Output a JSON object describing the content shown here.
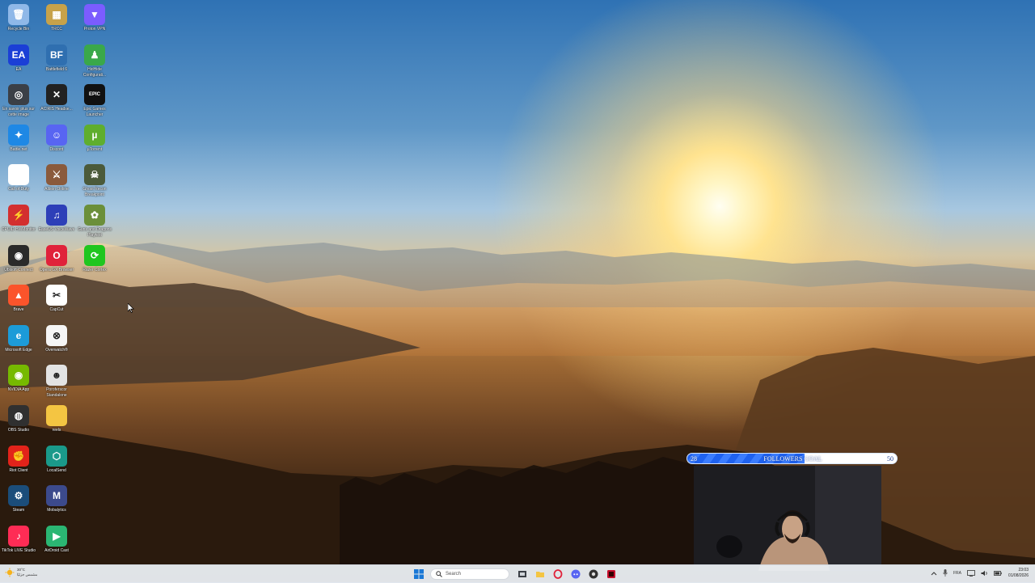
{
  "desktop": {
    "icons": [
      {
        "label": "Recycle Bin",
        "icon": "recycle-bin-icon",
        "color": "#8fb8e8",
        "glyph": "🗑"
      },
      {
        "label": "TRCC",
        "icon": "trcc-icon",
        "color": "#c7a24a",
        "glyph": "▦"
      },
      {
        "label": "Proton VPN",
        "icon": "proton-vpn-icon",
        "color": "#7b5cff",
        "glyph": "▼"
      },
      {
        "label": "EA",
        "icon": "ea-icon",
        "color": "#1b3fd6",
        "glyph": "EA"
      },
      {
        "label": "Battlefield 6",
        "icon": "battlefield-icon",
        "color": "#2f6fb0",
        "glyph": "BF"
      },
      {
        "label": "HidHide Configurati...",
        "icon": "hidhide-icon",
        "color": "#3aa84a",
        "glyph": "♟"
      },
      {
        "label": "En savoir plus sur cette image",
        "icon": "camera-info-icon",
        "color": "#3b3f46",
        "glyph": "◎"
      },
      {
        "label": "ACIRIS Headse...",
        "icon": "headset-icon",
        "color": "#222222",
        "glyph": "✕"
      },
      {
        "label": "Epic Games Launcher",
        "icon": "epic-games-icon",
        "color": "#111111",
        "glyph": "EPIC"
      },
      {
        "label": "Battle.net",
        "icon": "battlenet-icon",
        "color": "#1e88e5",
        "glyph": "✦"
      },
      {
        "label": "Discord",
        "icon": "discord-icon",
        "color": "#5865f2",
        "glyph": "☺"
      },
      {
        "label": "µTorrent",
        "icon": "utorrent-icon",
        "color": "#5fae2e",
        "glyph": "µ"
      },
      {
        "label": "Call of Duty",
        "icon": "file-icon",
        "color": "#ffffff",
        "glyph": ""
      },
      {
        "label": "Albion Online",
        "icon": "albion-icon",
        "color": "#8a5a3c",
        "glyph": "⚔"
      },
      {
        "label": "Ghost Recon Breakpoint",
        "icon": "ghost-recon-icon",
        "color": "#4b5a3a",
        "glyph": "☠"
      },
      {
        "label": "CPUID HWMonitor",
        "icon": "hwmonitor-icon",
        "color": "#d32f2f",
        "glyph": "⚡"
      },
      {
        "label": "EaseUS VoiceWave",
        "icon": "voicewave-icon",
        "color": "#2d3fb8",
        "glyph": "♫"
      },
      {
        "label": "Guns and Dragons Playtest",
        "icon": "guns-dragons-icon",
        "color": "#6b8f3a",
        "glyph": "✿"
      },
      {
        "label": "Ubisoft Connect",
        "icon": "ubisoft-icon",
        "color": "#2a2a2a",
        "glyph": "◉"
      },
      {
        "label": "Opera GX Browser",
        "icon": "opera-gx-icon",
        "color": "#e0223a",
        "glyph": "O"
      },
      {
        "label": "Razer Cortex",
        "icon": "razer-cortex-icon",
        "color": "#1fc61f",
        "glyph": "⟳"
      },
      {
        "label": "Brave",
        "icon": "brave-icon",
        "color": "#fb542b",
        "glyph": "▲"
      },
      {
        "label": "CapCut",
        "icon": "capcut-icon",
        "color": "#ffffff",
        "glyph": "✂"
      },
      {
        "label": "",
        "icon": "blank-icon",
        "color": "transparent",
        "glyph": ""
      },
      {
        "label": "Microsoft Edge",
        "icon": "edge-icon",
        "color": "#1c9bd8",
        "glyph": "e"
      },
      {
        "label": "Overwatch®",
        "icon": "overwatch-icon",
        "color": "#f5f5f5",
        "glyph": "⊗"
      },
      {
        "label": "",
        "icon": "blank-icon",
        "color": "transparent",
        "glyph": ""
      },
      {
        "label": "NVIDIA App",
        "icon": "nvidia-icon",
        "color": "#76b900",
        "glyph": "◉"
      },
      {
        "label": "Poroferscor Standalone",
        "icon": "poro-icon",
        "color": "#e3e3e3",
        "glyph": "☻"
      },
      {
        "label": "",
        "icon": "blank-icon",
        "color": "transparent",
        "glyph": ""
      },
      {
        "label": "OBS Studio",
        "icon": "obs-icon",
        "color": "#303030",
        "glyph": "◍"
      },
      {
        "label": "reels",
        "icon": "folder-icon",
        "color": "#f4c542",
        "glyph": ""
      },
      {
        "label": "",
        "icon": "blank-icon",
        "color": "transparent",
        "glyph": ""
      },
      {
        "label": "Riot Client",
        "icon": "riot-icon",
        "color": "#e2231a",
        "glyph": "✊"
      },
      {
        "label": "LocalSend",
        "icon": "localsend-icon",
        "color": "#1a9a8a",
        "glyph": "⬡"
      },
      {
        "label": "",
        "icon": "blank-icon",
        "color": "transparent",
        "glyph": ""
      },
      {
        "label": "Steam",
        "icon": "steam-icon",
        "color": "#1b4d7a",
        "glyph": "⚙"
      },
      {
        "label": "Mobalytics",
        "icon": "mobalytics-icon",
        "color": "#3c4a8c",
        "glyph": "M"
      },
      {
        "label": "",
        "icon": "blank-icon",
        "color": "transparent",
        "glyph": ""
      },
      {
        "label": "TikTok LIVE Studio",
        "icon": "tiktok-live-icon",
        "color": "#fe2c55",
        "glyph": "♪"
      },
      {
        "label": "AirDroid Cast",
        "icon": "airdroid-icon",
        "color": "#2bb673",
        "glyph": "▶"
      }
    ]
  },
  "overlay": {
    "goal_title": "FOLLOWERS GOAL",
    "current": 28,
    "target": 50,
    "progress_fraction": 0.56
  },
  "taskbar": {
    "weather_temp": "30°C",
    "weather_desc": "مشمس جزئيًا",
    "search_placeholder": "Search",
    "apps": [
      "windows-start-icon",
      "search-icon",
      "task-view-icon",
      "file-explorer-icon",
      "opera-gx-icon",
      "discord-icon",
      "obs-icon",
      "app-icon"
    ],
    "tray_lang": "FRA",
    "clock_time": "23:03",
    "clock_date": "01/08/2026"
  }
}
